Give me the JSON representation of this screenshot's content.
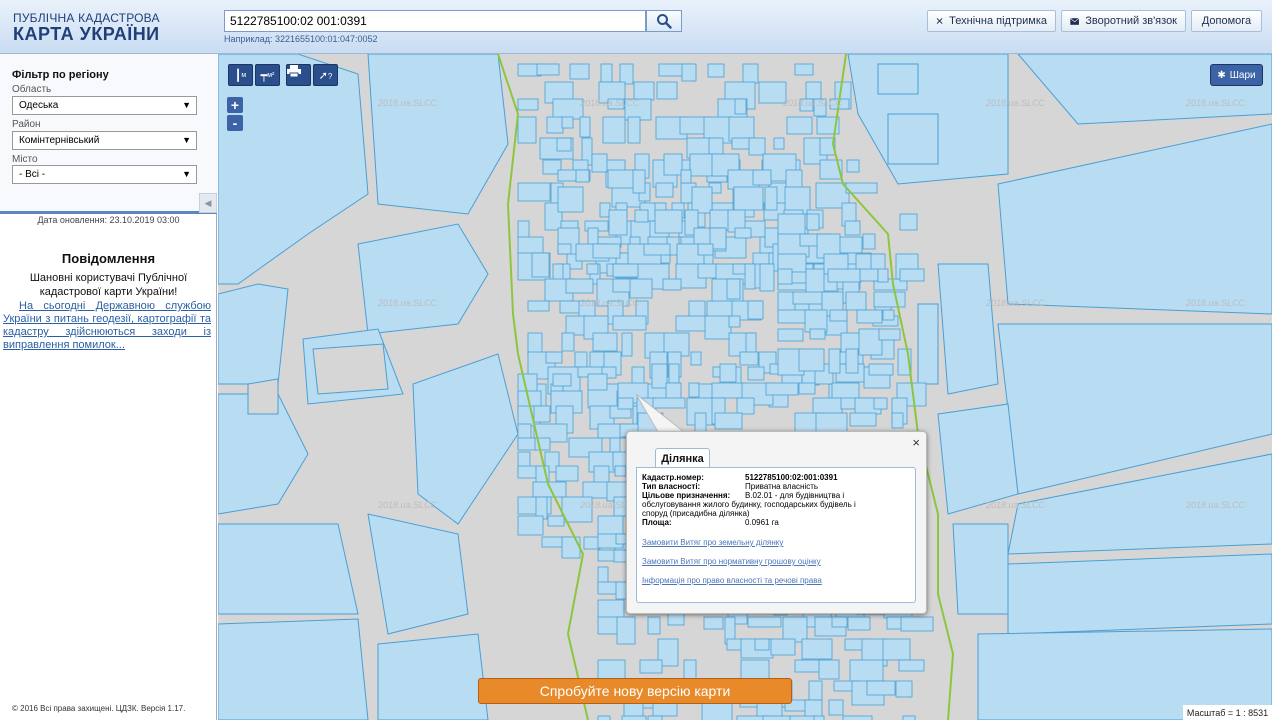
{
  "header": {
    "logo_line1": "ПУБЛІЧНА КАДАСТРОВА",
    "logo_line2": "КАРТА УКРАЇНИ",
    "search_value": "5122785100:02 001:0391",
    "search_hint": "Наприклад: 3221655100:01:047:0052",
    "buttons": {
      "support": "Технічна підтримка",
      "feedback": "Зворотний зв'язок",
      "help": "Допомога"
    }
  },
  "sidebar": {
    "filter_title": "Фільтр по регіону",
    "region_label": "Область",
    "region_value": "Одеська",
    "district_label": "Район",
    "district_value": "Комінтернівський",
    "city_label": "Місто",
    "city_value": "- Всі -",
    "updated": "Дата оновлення: 23.10.2019 03:00",
    "notice_title": "Повідомлення",
    "notice_text": "Шановні користувачі Публічної кадастрової карти України!",
    "notice_link": "На сьогодні Державною службою України з питань геодезії, картографії та кадастру здійснюються заходи із виправлення помилок...",
    "copyright": "© 2016 Всі права захищені. ЦДЗК. Версія 1.17."
  },
  "map": {
    "tools": {
      "measure_line": "м",
      "measure_area": "м²",
      "print": "print-icon",
      "identify": "?"
    },
    "layers_label": "Шари",
    "watermark": "2018.ua.SLCC",
    "new_version": "Спробуйте нову версію карти",
    "scale": "Масштаб = 1 : 8531",
    "popup": {
      "tab": "Ділянка",
      "cadnum_label": "Кадастр.номер:",
      "cadnum_value": "5122785100:02:001:0391",
      "ownership_label": "Тип власності:",
      "ownership_value": "Приватна власність",
      "purpose_label": "Цільове призначення:",
      "purpose_value_1": "В.02.01 - для будівництва і",
      "purpose_value_2": "обслуговування жилого будинку, господарських будівель і",
      "purpose_value_3": "споруд (присадибна ділянка)",
      "area_label": "Площа:",
      "area_value": "0.0961 га",
      "link1": "Замовити Витяг про земельну ділянку",
      "link2": "Замовити Витяг про нормативну грошову оцінку",
      "link3": "Інформація про право власності та речові права"
    }
  },
  "colors": {
    "parcel_fill": "#b8dcf2",
    "parcel_stroke": "#4a9fd4",
    "boundary": "#8cc63f",
    "map_bg": "#d6d6d6",
    "accent": "#e98a2a"
  }
}
